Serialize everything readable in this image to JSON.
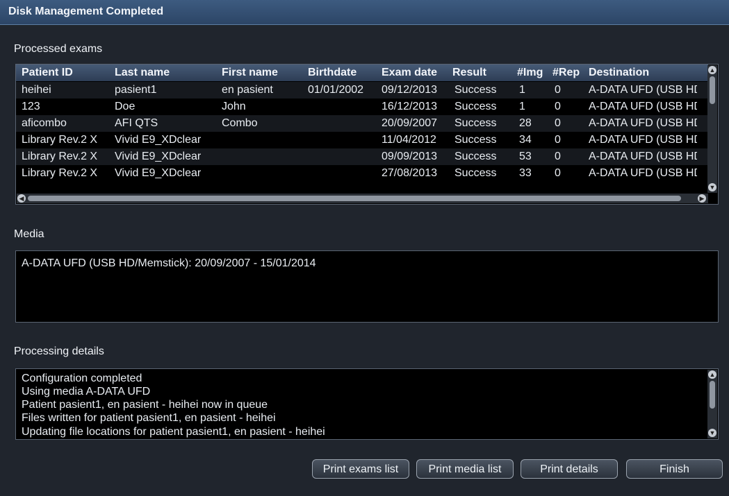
{
  "window": {
    "title": "Disk Management Completed"
  },
  "exams": {
    "label": "Processed exams",
    "columns": [
      "Patient ID",
      "Last name",
      "First name",
      "Birthdate",
      "Exam date",
      "Result",
      "#Img",
      "#Rep",
      "Destination"
    ],
    "rows": [
      [
        "heihei",
        "pasient1",
        "en pasient",
        "01/01/2002",
        "09/12/2013",
        "Success",
        "1",
        "0",
        "A-DATA UFD (USB HD/Memstick)"
      ],
      [
        "123",
        "Doe",
        "John",
        "",
        "16/12/2013",
        "Success",
        "1",
        "0",
        "A-DATA UFD (USB HD/Memstick)"
      ],
      [
        "aficombo",
        "AFI QTS",
        "Combo",
        "",
        "20/09/2007",
        "Success",
        "28",
        "0",
        "A-DATA UFD (USB HD/Memstick)"
      ],
      [
        "Library Rev.2 X",
        "Vivid E9_XDclear",
        "",
        "",
        "11/04/2012",
        "Success",
        "34",
        "0",
        "A-DATA UFD (USB HD/Memstick)"
      ],
      [
        "Library Rev.2 X",
        "Vivid E9_XDclear",
        "",
        "",
        "09/09/2013",
        "Success",
        "53",
        "0",
        "A-DATA UFD (USB HD/Memstick)"
      ],
      [
        "Library Rev.2 X",
        "Vivid E9_XDclear",
        "",
        "",
        "27/08/2013",
        "Success",
        "33",
        "0",
        "A-DATA UFD (USB HD/Memstick)"
      ]
    ]
  },
  "media": {
    "label": "Media",
    "text": "A-DATA UFD (USB HD/Memstick): 20/09/2007 - 15/01/2014"
  },
  "details": {
    "label": "Processing details",
    "lines": [
      "Configuration completed",
      "Using media A-DATA UFD",
      "Patient pasient1, en pasient - heihei now in queue",
      "Files written for patient pasient1, en pasient - heihei",
      "Updating file locations for patient pasient1, en pasient - heihei"
    ]
  },
  "buttons": {
    "print_exams": "Print exams list",
    "print_media": "Print media list",
    "print_details": "Print details",
    "finish": "Finish"
  },
  "icons": {
    "scroll_up": "scroll-up-icon",
    "scroll_down": "scroll-down-icon",
    "scroll_left": "scroll-left-icon",
    "scroll_right": "scroll-right-icon"
  }
}
